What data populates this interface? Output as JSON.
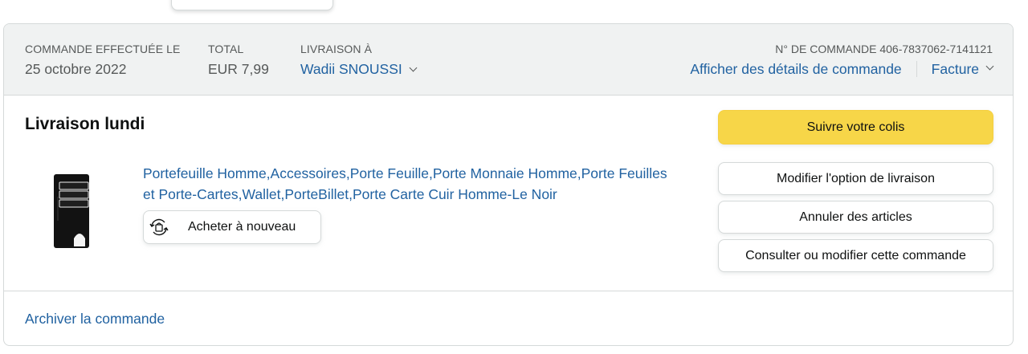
{
  "header": {
    "order_date_label": "COMMANDE EFFECTUÉE LE",
    "order_date": "25 octobre 2022",
    "total_label": "TOTAL",
    "total": "EUR 7,99",
    "ship_to_label": "LIVRAISON À",
    "ship_to_name": "Wadii SNOUSSI",
    "order_number": "N° DE COMMANDE 406-7837062-7141121",
    "details_link": "Afficher des détails de commande",
    "invoice_link": "Facture"
  },
  "shipment": {
    "title": "Livraison lundi",
    "product": {
      "title": "Portefeuille Homme,Accessoires,Porte Feuille,Porte Monnaie Homme,Porte Feuilles et Porte-Cartes,Wallet,PorteBillet,Porte Carte Cuir Homme-Le Noir",
      "image_icon": "wallet-image",
      "buy_again_label": "Acheter à nouveau",
      "buy_again_icon": "reorder-icon"
    },
    "actions": {
      "track": "Suivre votre colis",
      "modify_shipping": "Modifier l'option de livraison",
      "cancel": "Annuler des articles",
      "view_edit": "Consulter ou modifier cette commande"
    }
  },
  "footer": {
    "archive_link": "Archiver la commande"
  },
  "colors": {
    "link": "#2162a1",
    "header_bg": "#f0f2f2",
    "primary_button": "#f7d648",
    "border": "#d5d9d9"
  }
}
